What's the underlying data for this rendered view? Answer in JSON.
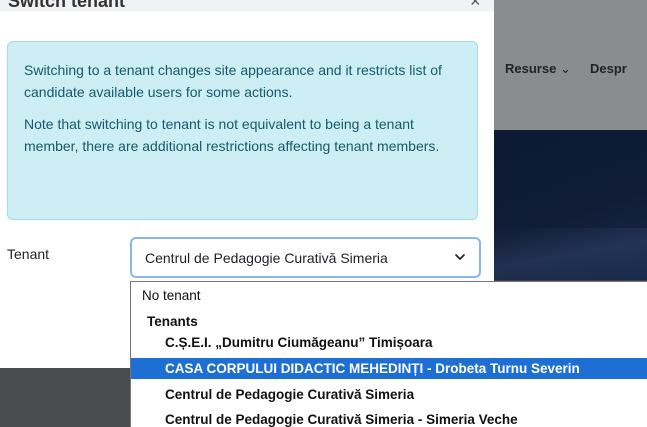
{
  "modal": {
    "title": "Switch tenant",
    "close_label": "×",
    "info_paragraph_1": "Switching to a tenant changes site appearance and it restricts list of candidate available users for some actions.",
    "info_paragraph_2": "Note that switching to tenant is not equivalent to being a tenant member, there are additional restrictions affecting tenant members.",
    "field_label": "Tenant",
    "selected_value": "Centrul de Pedagogie Curativă Simeria"
  },
  "dropdown": {
    "no_tenant": "No tenant",
    "group_label": "Tenants",
    "options": [
      "C.Ș.E.I. „Dumitru Ciumăgeanu” Timișoara",
      "CASA CORPULUI DIDACTIC MEHEDINȚI - Drobeta Turnu Severin",
      "Centrul de Pedagogie Curativă Simeria",
      "Centrul de Pedagogie Curativă Simeria - Simeria Veche"
    ],
    "highlighted_index": 1,
    "highlight_color": "#1e6fd4"
  },
  "background_nav": {
    "item_1": "Resurse",
    "item_2": "Despr"
  }
}
